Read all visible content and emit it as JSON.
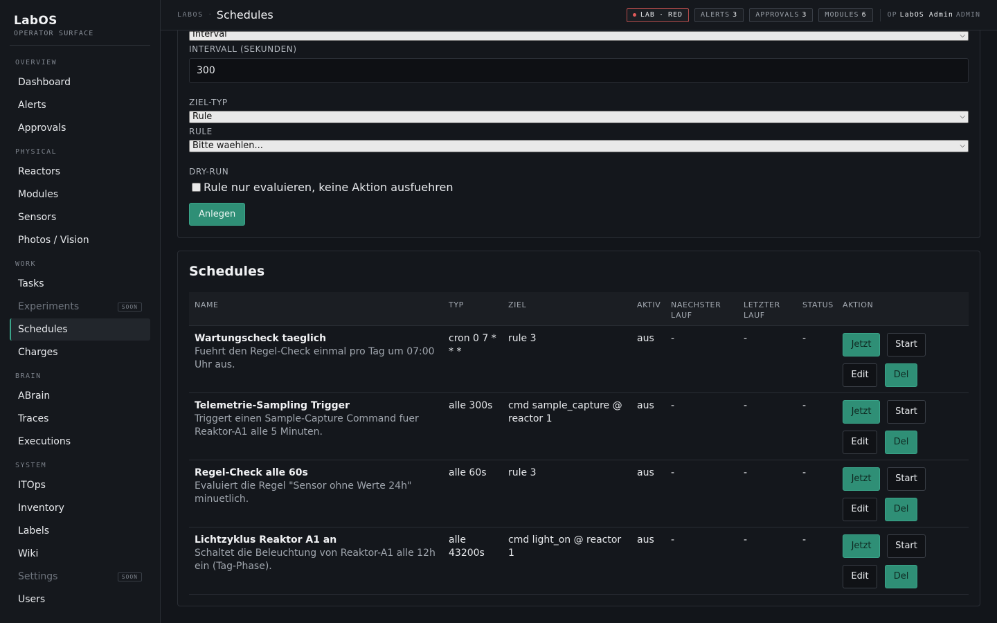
{
  "app": {
    "title": "LabOS",
    "subtitle": "OPERATOR SURFACE"
  },
  "sidebar": {
    "sections": [
      {
        "label": "OVERVIEW",
        "items": [
          {
            "label": "Dashboard"
          },
          {
            "label": "Alerts"
          },
          {
            "label": "Approvals"
          }
        ]
      },
      {
        "label": "PHYSICAL",
        "items": [
          {
            "label": "Reactors"
          },
          {
            "label": "Modules"
          },
          {
            "label": "Sensors"
          },
          {
            "label": "Photos / Vision"
          }
        ]
      },
      {
        "label": "WORK",
        "items": [
          {
            "label": "Tasks"
          },
          {
            "label": "Experiments",
            "badge": "SOON"
          },
          {
            "label": "Schedules",
            "active": true
          },
          {
            "label": "Charges"
          }
        ]
      },
      {
        "label": "BRAIN",
        "items": [
          {
            "label": "ABrain"
          },
          {
            "label": "Traces"
          },
          {
            "label": "Executions"
          }
        ]
      },
      {
        "label": "SYSTEM",
        "items": [
          {
            "label": "ITOps"
          },
          {
            "label": "Inventory"
          },
          {
            "label": "Labels"
          },
          {
            "label": "Wiki"
          },
          {
            "label": "Settings",
            "badge": "SOON"
          },
          {
            "label": "Users"
          }
        ]
      }
    ]
  },
  "header": {
    "breadcrumb_root": "LABOS",
    "breadcrumb_sep": "·",
    "title": "Schedules",
    "lab": {
      "label": "LAB",
      "sep": "·",
      "value": "RED"
    },
    "alerts": {
      "label": "ALERTS",
      "count": "3"
    },
    "approvals": {
      "label": "APPROVALS",
      "count": "3"
    },
    "modules": {
      "label": "MODULES",
      "count": "6"
    },
    "operator": {
      "prefix": "OP",
      "name": "LabOS Admin",
      "role": "ADMIN"
    }
  },
  "form": {
    "type_value": "Interval",
    "interval_label": "INTERVALL (SEKUNDEN)",
    "interval_value": "300",
    "target_type_label": "ZIEL-TYP",
    "target_type_value": "Rule",
    "rule_label": "RULE",
    "rule_placeholder": "Bitte waehlen...",
    "dryrun_label": "DRY-RUN",
    "dryrun_text": "Rule nur evaluieren, keine Aktion ausfuehren",
    "submit_label": "Anlegen"
  },
  "schedules": {
    "title": "Schedules",
    "columns": {
      "name": "NAME",
      "typ": "TYP",
      "ziel": "ZIEL",
      "aktiv": "AKTIV",
      "next_l1": "NAECHSTER",
      "next_l2": "LAUF",
      "last_l1": "LETZTER",
      "last_l2": "LAUF",
      "status": "STATUS",
      "aktion": "AKTION"
    },
    "actions": {
      "now": "Jetzt",
      "start": "Start",
      "edit": "Edit",
      "del": "Del"
    },
    "rows": [
      {
        "name": "Wartungscheck taeglich",
        "desc": "Fuehrt den Regel-Check einmal pro Tag um 07:00 Uhr aus.",
        "typ_l1": "cron 0 7 *",
        "typ_l2": "* *",
        "ziel_l1": "rule 3",
        "ziel_l2": "",
        "aktiv": "aus",
        "next": "-",
        "last": "-",
        "status": "-"
      },
      {
        "name": "Telemetrie-Sampling Trigger",
        "desc": "Triggert einen Sample-Capture Command fuer Reaktor-A1 alle 5 Minuten.",
        "typ_l1": "alle 300s",
        "typ_l2": "",
        "ziel_l1": "cmd sample_capture @",
        "ziel_l2": "reactor 1",
        "aktiv": "aus",
        "next": "-",
        "last": "-",
        "status": "-"
      },
      {
        "name": "Regel-Check alle 60s",
        "desc": "Evaluiert die Regel \"Sensor ohne Werte 24h\" minuetlich.",
        "typ_l1": "alle 60s",
        "typ_l2": "",
        "ziel_l1": "rule 3",
        "ziel_l2": "",
        "aktiv": "aus",
        "next": "-",
        "last": "-",
        "status": "-"
      },
      {
        "name": "Lichtzyklus Reaktor A1 an",
        "desc": "Schaltet die Beleuchtung von Reaktor-A1 alle 12h ein (Tag-Phase).",
        "typ_l1": "alle",
        "typ_l2": "43200s",
        "ziel_l1": "cmd light_on @ reactor 1",
        "ziel_l2": "",
        "aktiv": "aus",
        "next": "-",
        "last": "-",
        "status": "-"
      }
    ]
  }
}
